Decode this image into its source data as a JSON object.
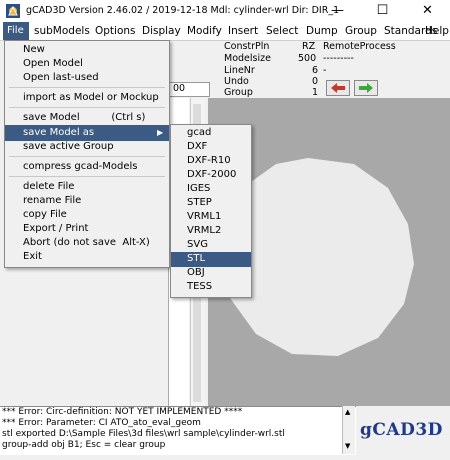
{
  "window": {
    "title": "gCAD3D Version 2.46.02 / 2019-12-18  Mdl: cylinder-wrl   Dir: DIR_1",
    "minimize": "—",
    "maximize": "☐",
    "close": "✕"
  },
  "menubar": [
    "File",
    "subModels",
    "Options",
    "Display",
    "Modify",
    "Insert",
    "Select",
    "Dump",
    "Group",
    "Standards",
    "Help"
  ],
  "status": {
    "row1": {
      "label": "ConstrPln",
      "value": "RZ",
      "extra": "RemoteProcess"
    },
    "row2": {
      "label": "Modelsize",
      "value": "500",
      "extra": "---------"
    },
    "row3": {
      "label": "LineNr",
      "value": "6",
      "extra": "-"
    },
    "row4": {
      "label": "Undo",
      "value": "0"
    },
    "row5": {
      "label": "Group",
      "value": "1"
    },
    "left_value": "00"
  },
  "nav": {
    "back_color": "#c0392b",
    "fwd_color": "#3aa835"
  },
  "file_menu": {
    "items": [
      "New",
      "Open Model",
      "Open last-used",
      "import as Model or Mockup",
      "save Model          (Ctrl s)",
      "save Model as",
      "save active Group",
      "compress gcad-Models",
      "delete File",
      "rename File",
      "copy File",
      "Export / Print",
      "Abort (do not save  Alt-X)",
      "Exit"
    ],
    "arrow": "▶"
  },
  "save_as_submenu": [
    "gcad",
    "DXF",
    "DXF-R10",
    "DXF-2000",
    "IGES",
    "STEP",
    "VRML1",
    "VRML2",
    "SVG",
    "STL",
    "OBJ",
    "TESS"
  ],
  "messages": [
    "*** Error: Circ-definition: NOT YET IMPLEMENTED ****",
    "*** Error: Parameter: CI ATO_ato_eval_geom",
    "stl exported D:\\Sample Files\\3d files\\wrl sample\\cylinder-wrl.stl",
    "group-add obj B1; Esc = clear group"
  ],
  "logo": "gCAD3D",
  "colors": {
    "highlight": "#3b5a84",
    "viewport_bg": "#a8a8a8",
    "shape": "#ebebeb"
  }
}
